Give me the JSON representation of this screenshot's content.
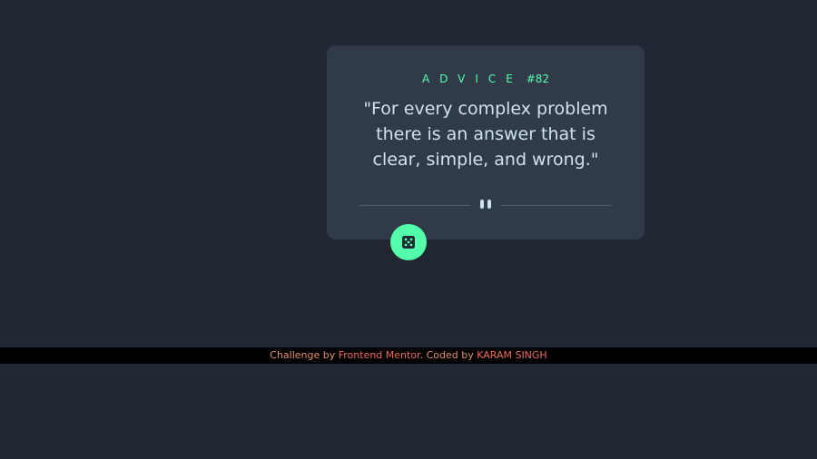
{
  "card": {
    "label_word": "ADVICE",
    "advice_number": "#82",
    "quote": "\"For every complex problem there is an answer that is clear, simple, and wrong.\""
  },
  "dice_button": {
    "icon": "dice-icon"
  },
  "divider": {
    "icon": "pause-icon"
  },
  "footer": {
    "prefix": "Challenge by ",
    "link1": "Frontend Mentor",
    "middle": ". Coded by ",
    "link2": "KARAM SINGH"
  },
  "colors": {
    "background": "#202632",
    "card": "#313a49",
    "accent": "#53ffaa",
    "quote_text": "#cee3e9",
    "footer_text": "#e38e63",
    "footer_link": "#ef6a54"
  }
}
